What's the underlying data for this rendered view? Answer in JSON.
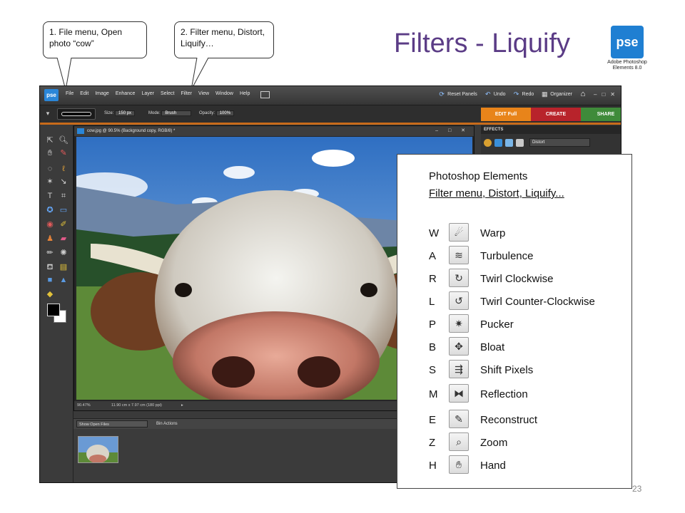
{
  "callouts": [
    {
      "text": "1. File menu, Open photo “cow”"
    },
    {
      "text": "2. Filter menu, Distort, Liquify…"
    }
  ],
  "slide": {
    "title": "Filters - Liquify",
    "page_number": "23",
    "logo": {
      "text": "pse",
      "caption": "Adobe Photoshop Elements 8.0"
    }
  },
  "app": {
    "logo_text": "pse",
    "menu": [
      "File",
      "Edit",
      "Image",
      "Enhance",
      "Layer",
      "Select",
      "Filter",
      "View",
      "Window",
      "Help"
    ],
    "right_toolbar": {
      "reset_panels": "Reset Panels",
      "undo": "Undo",
      "redo": "Redo",
      "organizer": "Organizer"
    },
    "options": {
      "size_label": "Size:",
      "size_value": "150 px",
      "mode_label": "Mode:",
      "mode_value": "Brush",
      "opacity_label": "Opacity:",
      "opacity_value": "100%"
    },
    "edit_tabs": [
      {
        "label": "EDIT Full",
        "color": "#e8841a"
      },
      {
        "label": "CREATE",
        "color": "#b8232b"
      },
      {
        "label": "SHARE",
        "color": "#3f8b3a"
      }
    ],
    "document": {
      "title": "cow.jpg @ 90.5% (Background copy, RGB/8) *",
      "zoom": "90.47%",
      "dimensions": "11.90 cm x 7.97 cm (180 ppi)"
    },
    "bin": {
      "show_select": "Show Open Files",
      "actions": "Bin Actions"
    },
    "effects": {
      "header": "EFFECTS",
      "category": "Distort"
    }
  },
  "liquify_panel": {
    "heading": "Photoshop Elements",
    "subheading": "Filter menu, Distort, Liquify...",
    "tools": [
      {
        "key": "W",
        "name": "Warp",
        "icon": "warp-icon"
      },
      {
        "key": "A",
        "name": "Turbulence",
        "icon": "turbulence-icon"
      },
      {
        "key": "R",
        "name": "Twirl Clockwise",
        "icon": "twirl-clockwise-icon"
      },
      {
        "key": "L",
        "name": "Twirl Counter-Clockwise",
        "icon": "twirl-counter-clockwise-icon"
      },
      {
        "key": "P",
        "name": "Pucker",
        "icon": "pucker-icon"
      },
      {
        "key": "B",
        "name": "Bloat",
        "icon": "bloat-icon"
      },
      {
        "key": "S",
        "name": "Shift Pixels",
        "icon": "shift-pixels-icon"
      },
      {
        "key": "M",
        "name": "Reflection",
        "icon": "reflection-icon"
      },
      {
        "key": "E",
        "name": "Reconstruct",
        "icon": "reconstruct-icon"
      },
      {
        "key": "Z",
        "name": "Zoom",
        "icon": "zoom-icon"
      },
      {
        "key": "H",
        "name": "Hand",
        "icon": "hand-icon"
      }
    ]
  }
}
